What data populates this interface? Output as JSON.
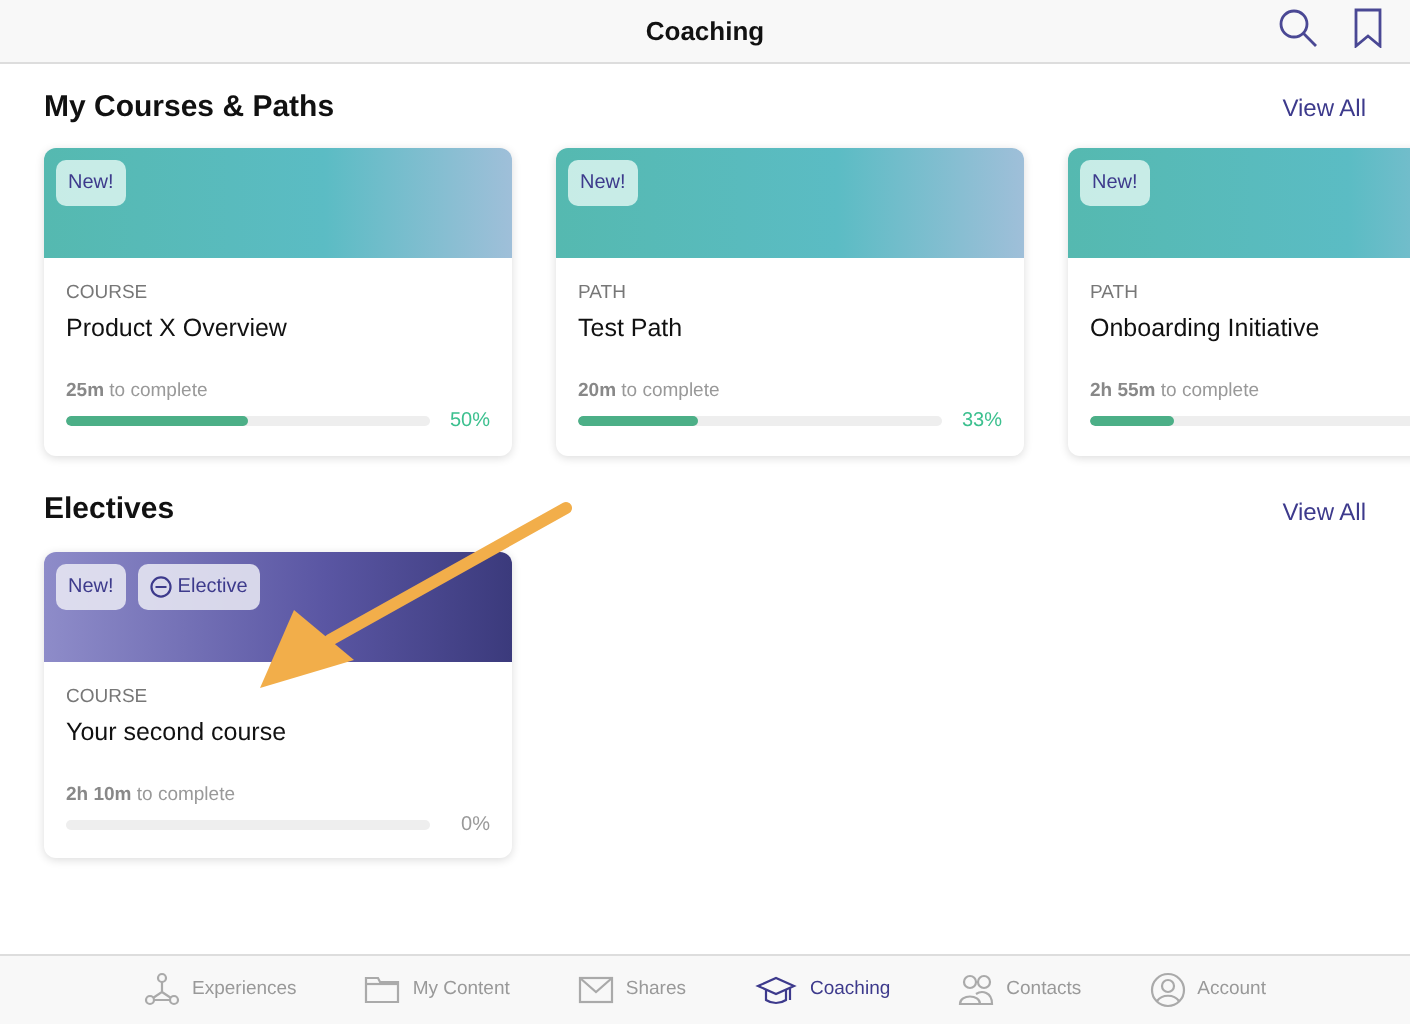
{
  "header": {
    "title": "Coaching"
  },
  "sections": [
    {
      "title": "My Courses & Paths",
      "link": "View All",
      "cards": [
        {
          "badges": [
            {
              "kind": "new",
              "label": "New!"
            }
          ],
          "type": "COURSE",
          "title": "Product X Overview",
          "duration": "**25m** to complete",
          "level": 0.5,
          "percent": "50%"
        },
        {
          "badges": [
            {
              "kind": "new",
              "label": "New!"
            }
          ],
          "type": "PATH",
          "title": "Test Path",
          "duration": "**20m** to complete",
          "level": 0.33,
          "percent": "33%"
        },
        {
          "badges": [
            {
              "kind": "new",
              "label": "New!"
            }
          ],
          "type": "PATH",
          "title": "Onboarding Initiative",
          "duration": "**2h 55m** to complete",
          "level": 0.2
        }
      ]
    },
    {
      "title": "Electives",
      "link": "View All",
      "cards": [
        {
          "badges": [
            {
              "kind": "new",
              "label": "New!"
            },
            {
              "kind": "elective",
              "label": "Elective"
            }
          ],
          "type": "COURSE",
          "title": "Your second course",
          "duration": "**2h 10m** to complete",
          "level": 0,
          "percent": "0%"
        }
      ]
    }
  ],
  "tabbar": [
    {
      "label": "Experiences",
      "selected": false
    },
    {
      "label": "My Content",
      "selected": false
    },
    {
      "label": "Shares",
      "selected": false
    },
    {
      "label": "Coaching",
      "selected": true
    },
    {
      "label": "Contacts",
      "selected": false
    },
    {
      "label": "Account",
      "selected": false
    }
  ]
}
